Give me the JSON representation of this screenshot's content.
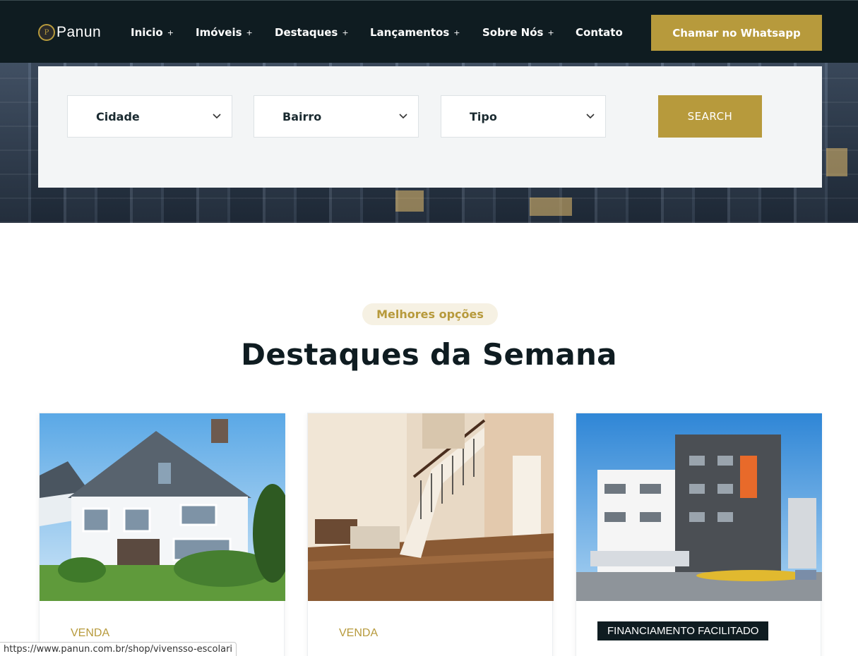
{
  "brand": {
    "name": "Panun",
    "accent": "#b79a3c",
    "dark": "#0f1c21"
  },
  "nav": {
    "items": [
      {
        "label": "Inicio",
        "has_submenu": true
      },
      {
        "label": "Imóveis",
        "has_submenu": true
      },
      {
        "label": "Destaques",
        "has_submenu": true
      },
      {
        "label": "Lançamentos",
        "has_submenu": true
      },
      {
        "label": "Sobre Nós",
        "has_submenu": true
      },
      {
        "label": "Contato",
        "has_submenu": false
      }
    ],
    "plus_symbol": "+",
    "cta_label": "Chamar no Whatsapp"
  },
  "search": {
    "fields": [
      {
        "label": "Cidade",
        "icon": "chevron-down-icon"
      },
      {
        "label": "Bairro",
        "icon": "chevron-down-icon"
      },
      {
        "label": "Tipo",
        "icon": "chevron-down-icon"
      }
    ],
    "button_label": "SEARCH"
  },
  "section": {
    "eyebrow": "Melhores opções",
    "title": "Destaques da Semana"
  },
  "cards": [
    {
      "image": "white-house-photo",
      "tag": "VENDA"
    },
    {
      "image": "staircase-interior-photo",
      "tag": "VENDA"
    },
    {
      "image": "apartment-building-photo",
      "tag": "FINANCIAMENTO FACILITADO"
    }
  ],
  "status_bar": {
    "url": "https://www.panun.com.br/shop/vivensso-escolari"
  }
}
